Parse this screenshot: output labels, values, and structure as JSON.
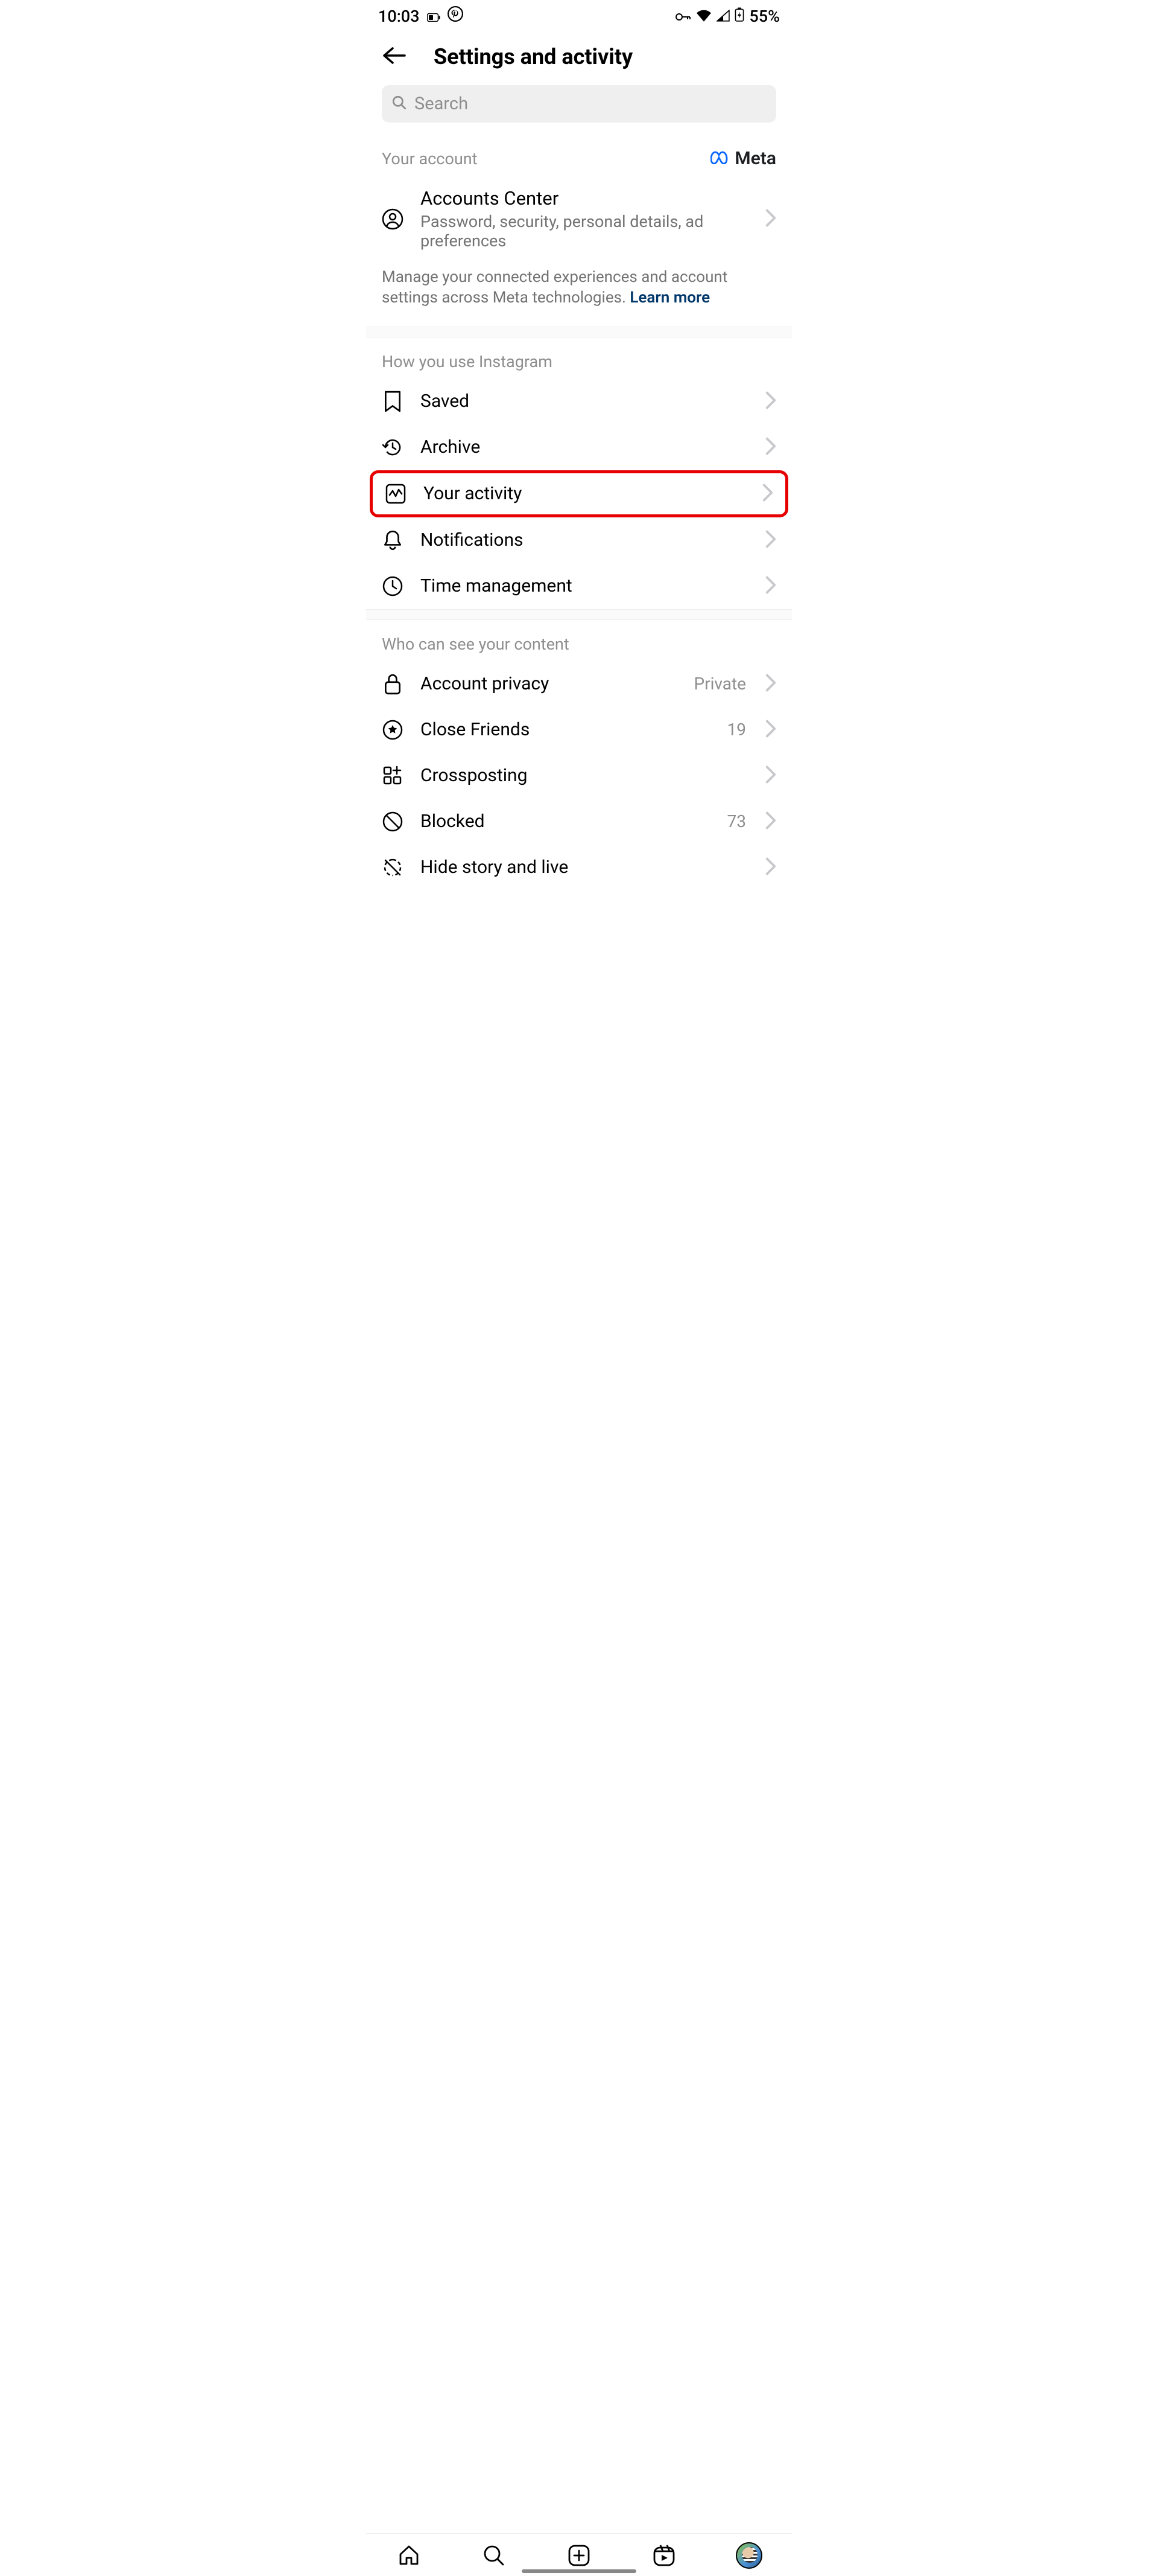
{
  "status": {
    "time": "10:03",
    "battery": "55%"
  },
  "header": {
    "title": "Settings and activity"
  },
  "search": {
    "placeholder": "Search"
  },
  "account_section": {
    "label": "Your account",
    "brand": "Meta",
    "item_title": "Accounts Center",
    "item_subtitle": "Password, security, personal details, ad preferences",
    "description_prefix": "Manage your connected experiences and account settings across Meta technologies. ",
    "learn_more": "Learn more"
  },
  "usage_section": {
    "label": "How you use Instagram",
    "items": {
      "saved": "Saved",
      "archive": "Archive",
      "your_activity": "Your activity",
      "notifications": "Notifications",
      "time_management": "Time management"
    }
  },
  "visibility_section": {
    "label": "Who can see your content",
    "items": {
      "account_privacy": {
        "label": "Account privacy",
        "value": "Private"
      },
      "close_friends": {
        "label": "Close Friends",
        "value": "19"
      },
      "crossposting": {
        "label": "Crossposting"
      },
      "blocked": {
        "label": "Blocked",
        "value": "73"
      },
      "hide_story": {
        "label": "Hide story and live"
      }
    }
  }
}
